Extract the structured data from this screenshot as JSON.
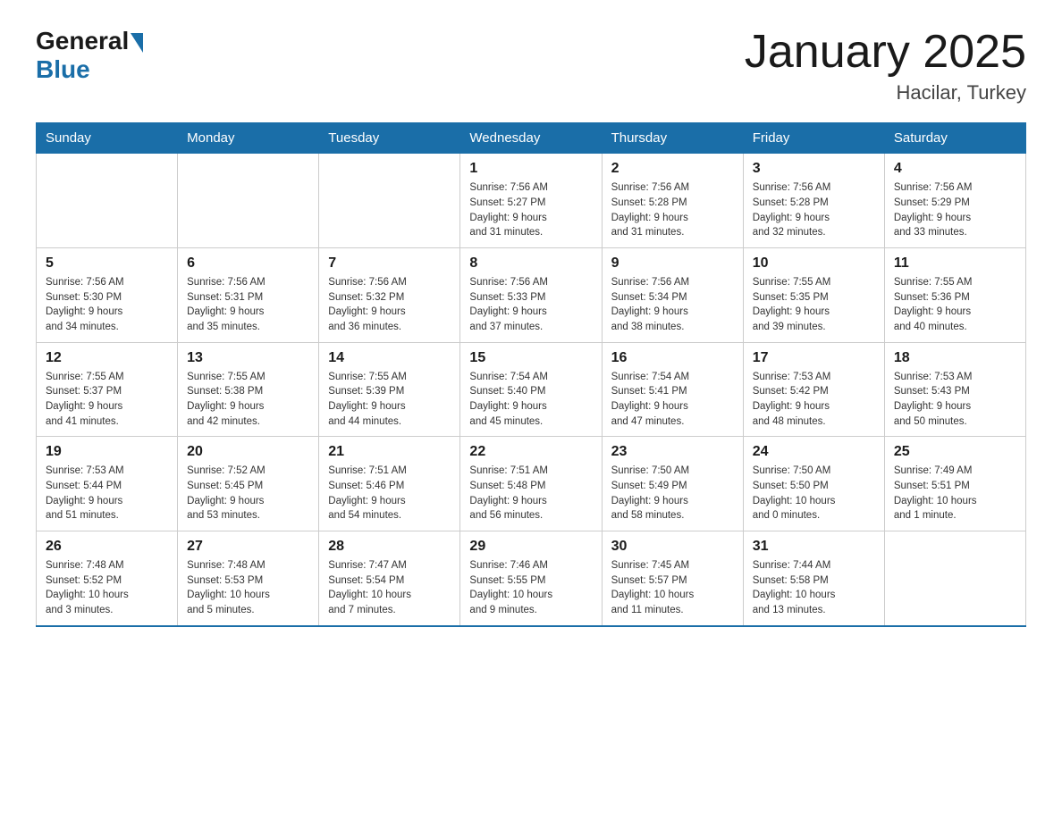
{
  "logo": {
    "general": "General",
    "blue": "Blue"
  },
  "title": "January 2025",
  "subtitle": "Hacilar, Turkey",
  "weekdays": [
    "Sunday",
    "Monday",
    "Tuesday",
    "Wednesday",
    "Thursday",
    "Friday",
    "Saturday"
  ],
  "weeks": [
    [
      {
        "day": "",
        "info": ""
      },
      {
        "day": "",
        "info": ""
      },
      {
        "day": "",
        "info": ""
      },
      {
        "day": "1",
        "info": "Sunrise: 7:56 AM\nSunset: 5:27 PM\nDaylight: 9 hours\nand 31 minutes."
      },
      {
        "day": "2",
        "info": "Sunrise: 7:56 AM\nSunset: 5:28 PM\nDaylight: 9 hours\nand 31 minutes."
      },
      {
        "day": "3",
        "info": "Sunrise: 7:56 AM\nSunset: 5:28 PM\nDaylight: 9 hours\nand 32 minutes."
      },
      {
        "day": "4",
        "info": "Sunrise: 7:56 AM\nSunset: 5:29 PM\nDaylight: 9 hours\nand 33 minutes."
      }
    ],
    [
      {
        "day": "5",
        "info": "Sunrise: 7:56 AM\nSunset: 5:30 PM\nDaylight: 9 hours\nand 34 minutes."
      },
      {
        "day": "6",
        "info": "Sunrise: 7:56 AM\nSunset: 5:31 PM\nDaylight: 9 hours\nand 35 minutes."
      },
      {
        "day": "7",
        "info": "Sunrise: 7:56 AM\nSunset: 5:32 PM\nDaylight: 9 hours\nand 36 minutes."
      },
      {
        "day": "8",
        "info": "Sunrise: 7:56 AM\nSunset: 5:33 PM\nDaylight: 9 hours\nand 37 minutes."
      },
      {
        "day": "9",
        "info": "Sunrise: 7:56 AM\nSunset: 5:34 PM\nDaylight: 9 hours\nand 38 minutes."
      },
      {
        "day": "10",
        "info": "Sunrise: 7:55 AM\nSunset: 5:35 PM\nDaylight: 9 hours\nand 39 minutes."
      },
      {
        "day": "11",
        "info": "Sunrise: 7:55 AM\nSunset: 5:36 PM\nDaylight: 9 hours\nand 40 minutes."
      }
    ],
    [
      {
        "day": "12",
        "info": "Sunrise: 7:55 AM\nSunset: 5:37 PM\nDaylight: 9 hours\nand 41 minutes."
      },
      {
        "day": "13",
        "info": "Sunrise: 7:55 AM\nSunset: 5:38 PM\nDaylight: 9 hours\nand 42 minutes."
      },
      {
        "day": "14",
        "info": "Sunrise: 7:55 AM\nSunset: 5:39 PM\nDaylight: 9 hours\nand 44 minutes."
      },
      {
        "day": "15",
        "info": "Sunrise: 7:54 AM\nSunset: 5:40 PM\nDaylight: 9 hours\nand 45 minutes."
      },
      {
        "day": "16",
        "info": "Sunrise: 7:54 AM\nSunset: 5:41 PM\nDaylight: 9 hours\nand 47 minutes."
      },
      {
        "day": "17",
        "info": "Sunrise: 7:53 AM\nSunset: 5:42 PM\nDaylight: 9 hours\nand 48 minutes."
      },
      {
        "day": "18",
        "info": "Sunrise: 7:53 AM\nSunset: 5:43 PM\nDaylight: 9 hours\nand 50 minutes."
      }
    ],
    [
      {
        "day": "19",
        "info": "Sunrise: 7:53 AM\nSunset: 5:44 PM\nDaylight: 9 hours\nand 51 minutes."
      },
      {
        "day": "20",
        "info": "Sunrise: 7:52 AM\nSunset: 5:45 PM\nDaylight: 9 hours\nand 53 minutes."
      },
      {
        "day": "21",
        "info": "Sunrise: 7:51 AM\nSunset: 5:46 PM\nDaylight: 9 hours\nand 54 minutes."
      },
      {
        "day": "22",
        "info": "Sunrise: 7:51 AM\nSunset: 5:48 PM\nDaylight: 9 hours\nand 56 minutes."
      },
      {
        "day": "23",
        "info": "Sunrise: 7:50 AM\nSunset: 5:49 PM\nDaylight: 9 hours\nand 58 minutes."
      },
      {
        "day": "24",
        "info": "Sunrise: 7:50 AM\nSunset: 5:50 PM\nDaylight: 10 hours\nand 0 minutes."
      },
      {
        "day": "25",
        "info": "Sunrise: 7:49 AM\nSunset: 5:51 PM\nDaylight: 10 hours\nand 1 minute."
      }
    ],
    [
      {
        "day": "26",
        "info": "Sunrise: 7:48 AM\nSunset: 5:52 PM\nDaylight: 10 hours\nand 3 minutes."
      },
      {
        "day": "27",
        "info": "Sunrise: 7:48 AM\nSunset: 5:53 PM\nDaylight: 10 hours\nand 5 minutes."
      },
      {
        "day": "28",
        "info": "Sunrise: 7:47 AM\nSunset: 5:54 PM\nDaylight: 10 hours\nand 7 minutes."
      },
      {
        "day": "29",
        "info": "Sunrise: 7:46 AM\nSunset: 5:55 PM\nDaylight: 10 hours\nand 9 minutes."
      },
      {
        "day": "30",
        "info": "Sunrise: 7:45 AM\nSunset: 5:57 PM\nDaylight: 10 hours\nand 11 minutes."
      },
      {
        "day": "31",
        "info": "Sunrise: 7:44 AM\nSunset: 5:58 PM\nDaylight: 10 hours\nand 13 minutes."
      },
      {
        "day": "",
        "info": ""
      }
    ]
  ]
}
